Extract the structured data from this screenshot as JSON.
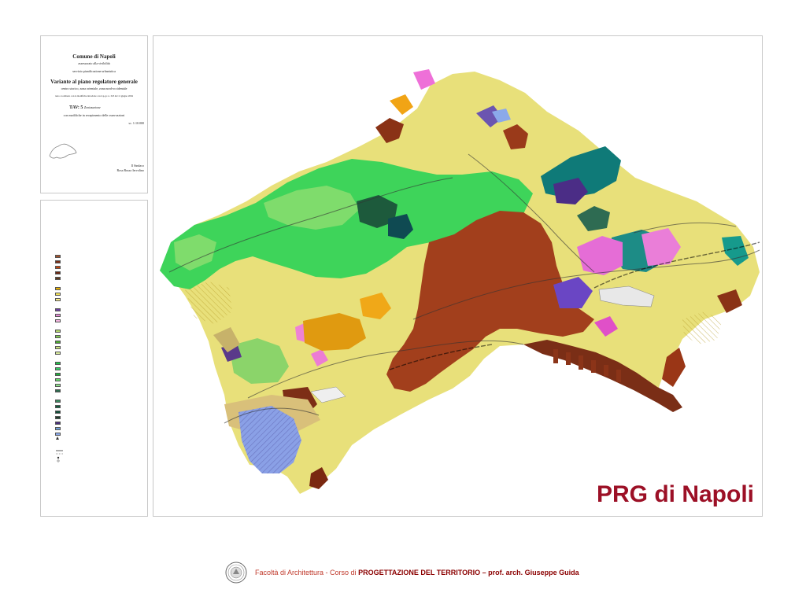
{
  "title_block": {
    "line1": "Comune di Napoli",
    "line2": "assessorato alla vivibilità",
    "line3": "servizio pianificazione urbanistica",
    "line4": "Variante al piano regolatore generale",
    "line5": "centro storico, zona orientale, zona nord-occidentale",
    "line6": "testo coordinato con le modifiche introdotte con d.p.g.r. n. 323 del 11 giugno 2004",
    "tav": "TAV: 5",
    "tav_desc": "Zonizzazione",
    "line7": "con modifiche in recepimento delle osservazioni",
    "scale": "sc. 1:10.000",
    "signature1": "Il Sindaco",
    "signature2": "Rosa Russo Iervolino"
  },
  "legend_colors": [
    "#a0522d",
    "#7a2e16",
    "#c1440e",
    "#6b2a14",
    "#5e3a1f",
    "#e8b000",
    "#f2e35a",
    "#f7ea8a",
    "#6b3fa0",
    "#e48ad6",
    "#f3b6e0",
    "#b3d66c",
    "#7ec850",
    "#4aa830",
    "#c9e07a",
    "#d6e89a",
    "#22c24a",
    "#33cc66",
    "#1fae3a",
    "#66d96b",
    "#8de28a",
    "#2f6b4f",
    "#3a8a5e",
    "#0f5a3c",
    "#124e3a",
    "#1f3d2d",
    "#4a2f7a",
    "#6fa0d8",
    "#8ba9ea"
  ],
  "map_title": "PRG di Napoli",
  "footer": {
    "faculty": "Facoltà di Architettura",
    "sep": " - Corso di ",
    "course": "PROGETTAZIONE DEL TERRITORIO – prof. arch. Giuseppe Guida"
  }
}
